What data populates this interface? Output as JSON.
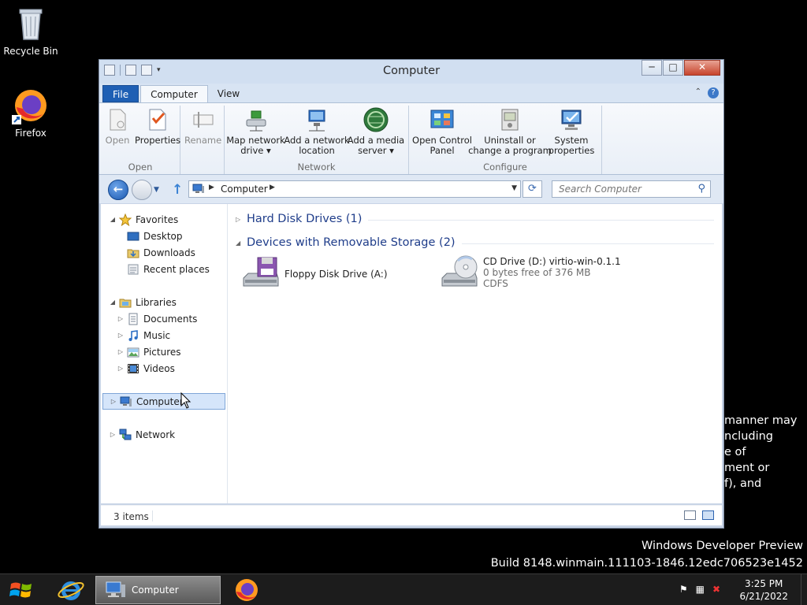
{
  "desktop": {
    "icons": [
      {
        "label": "Recycle Bin"
      },
      {
        "label": "Firefox"
      }
    ],
    "background_text": "manner may\nncluding\ne of\nment or\nf), and",
    "watermark_line1": "Windows Developer Preview",
    "watermark_line2": "Build 8148.winmain.111103-1846.12edc706523e1452"
  },
  "window": {
    "title": "Computer",
    "buttons": {
      "minimize": "─",
      "maximize": "□",
      "close": "✕"
    },
    "tabs": [
      {
        "label": "File"
      },
      {
        "label": "Computer"
      },
      {
        "label": "View"
      }
    ],
    "ribbon": {
      "groups": [
        {
          "label": "Open",
          "items": [
            {
              "label": "Open",
              "icon": "open-icon",
              "disabled": true
            },
            {
              "label": "Properties",
              "icon": "properties-icon",
              "disabled": false
            }
          ]
        },
        {
          "label": "",
          "items": [
            {
              "label": "Rename",
              "icon": "rename-icon",
              "disabled": true
            }
          ]
        },
        {
          "label": "Network",
          "items": [
            {
              "label": "Map network\ndrive ▾",
              "icon": "map-drive-icon",
              "disabled": false
            },
            {
              "label": "Add a network\nlocation",
              "icon": "network-location-icon",
              "disabled": false
            },
            {
              "label": "Add a media\nserver ▾",
              "icon": "media-server-icon",
              "disabled": false
            }
          ]
        },
        {
          "label": "Configure",
          "items": [
            {
              "label": "Open Control\nPanel",
              "icon": "control-panel-icon",
              "disabled": false
            },
            {
              "label": "Uninstall or\nchange a program",
              "icon": "uninstall-icon",
              "disabled": false
            },
            {
              "label": "System\nproperties",
              "icon": "system-properties-icon",
              "disabled": false
            }
          ]
        }
      ]
    },
    "address": {
      "crumb": "Computer",
      "search_placeholder": "Search Computer"
    },
    "nav": {
      "favorites": "Favorites",
      "favorites_items": [
        "Desktop",
        "Downloads",
        "Recent places"
      ],
      "libraries": "Libraries",
      "libraries_items": [
        "Documents",
        "Music",
        "Pictures",
        "Videos"
      ],
      "computer": "Computer",
      "network": "Network"
    },
    "content": {
      "groups": [
        {
          "header": "Hard Disk Drives (1)",
          "expanded": false
        },
        {
          "header": "Devices with Removable Storage (2)",
          "expanded": true
        }
      ],
      "drives": [
        {
          "name": "Floppy Disk Drive (A:)",
          "icon": "floppy-drive-icon"
        },
        {
          "name": "CD Drive (D:) virtio-win-0.1.1",
          "free": "0 bytes free of 376 MB",
          "fs": "CDFS",
          "icon": "cd-drive-icon"
        }
      ]
    },
    "status": {
      "count": "3 items"
    }
  },
  "taskbar": {
    "active_window": "Computer",
    "time": "3:25 PM",
    "date": "6/21/2022"
  },
  "colors": {
    "file_tab": "#1e5fb4",
    "group_header": "#1f3d8a",
    "selection": "#d5e5fa"
  }
}
